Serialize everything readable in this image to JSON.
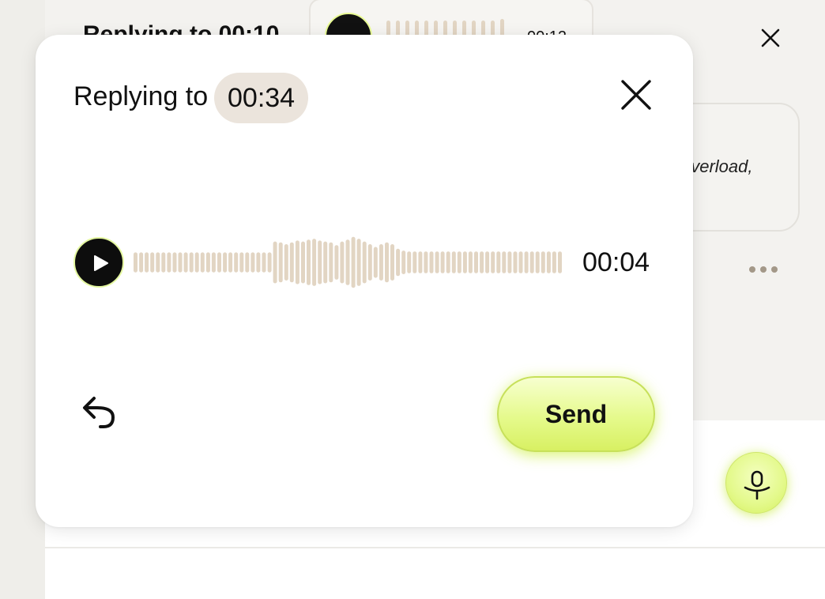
{
  "background": {
    "thread_title": "Replying to 00:10",
    "voice_note_time": "00:12",
    "message_snippet": "overload,",
    "more_icon": "more-horizontal-icon",
    "close_icon": "close-icon",
    "mic_icon": "microphone-icon"
  },
  "modal": {
    "reply_label": "Replying to",
    "reply_timestamp": "00:34",
    "close_icon": "close-icon",
    "player": {
      "play_icon": "play-icon",
      "duration": "00:04",
      "waveform_levels": [
        22,
        22,
        22,
        22,
        22,
        22,
        22,
        22,
        22,
        22,
        22,
        22,
        22,
        22,
        22,
        22,
        22,
        22,
        22,
        22,
        22,
        22,
        22,
        22,
        22,
        46,
        44,
        40,
        44,
        48,
        46,
        50,
        52,
        48,
        46,
        44,
        38,
        46,
        50,
        56,
        52,
        46,
        40,
        34,
        40,
        44,
        40,
        30,
        26,
        24,
        24,
        24,
        24,
        24,
        24,
        24,
        24,
        24,
        24,
        24,
        24,
        24,
        24,
        24,
        24,
        24,
        24,
        24,
        24,
        24,
        24,
        24,
        24,
        24,
        24,
        24,
        24
      ]
    },
    "undo_icon": "undo-icon",
    "send_label": "Send"
  },
  "colors": {
    "accent": "#e5fa8c",
    "chip": "#ebe4dc",
    "waveform": "#e2d5c3",
    "backdrop": "#f3f2ef"
  }
}
